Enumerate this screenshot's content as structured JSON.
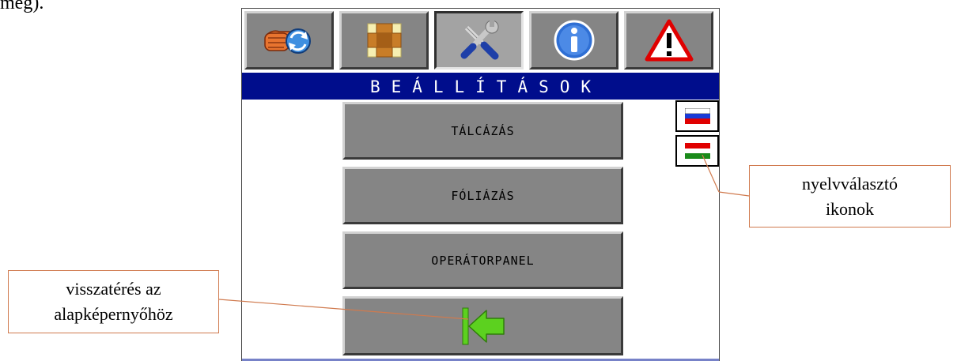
{
  "page_fragment": "meg).",
  "tabs": [
    {
      "name": "cycle-hand-icon"
    },
    {
      "name": "box-icon"
    },
    {
      "name": "tools-icon",
      "active": true
    },
    {
      "name": "info-icon"
    },
    {
      "name": "warning-icon"
    }
  ],
  "screen": {
    "title": "BEÁLLÍTÁSOK",
    "buttons": {
      "tray": "TÁLCÁZÁS",
      "foil": "FÓLIÁZÁS",
      "operator_panel": "OPERÁTORPANEL"
    },
    "back_icon": "back-arrow-icon",
    "languages": [
      "russian-flag-icon",
      "hungarian-flag-icon"
    ]
  },
  "callouts": {
    "language_line1": "nyelvválasztó",
    "language_line2": "ikonok",
    "back_line1": "visszatérés az",
    "back_line2": "alapképernyőhöz"
  },
  "colors": {
    "title_bar": "#000d8c",
    "button_face": "#858585",
    "back_arrow": "#5cd11f",
    "callout_border": "#d07a4e"
  }
}
